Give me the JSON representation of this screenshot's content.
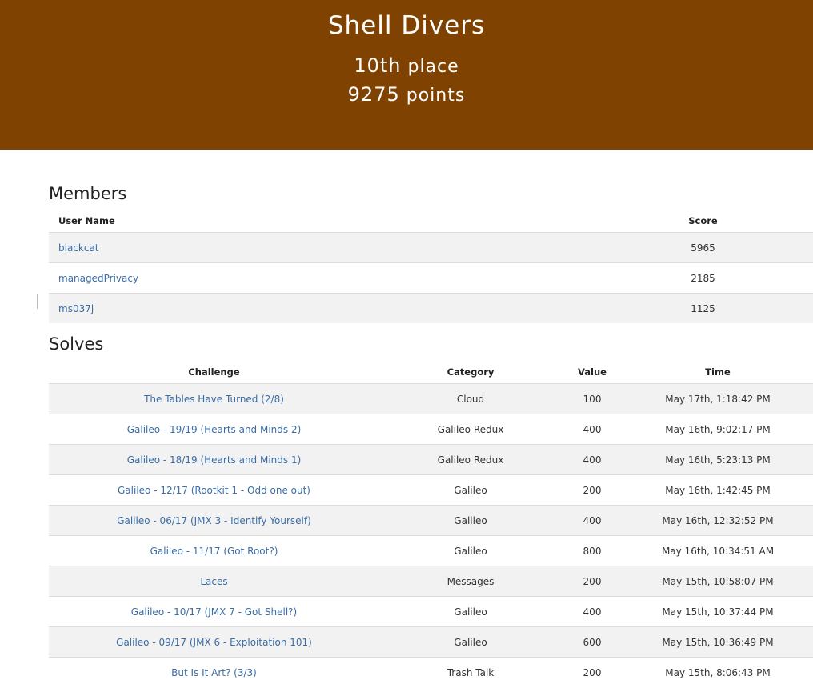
{
  "team": {
    "name": "Shell Divers",
    "place_number": "10th",
    "place_word": "place",
    "points_number": "9275",
    "points_word": "points",
    "banner_color": "#7f4201"
  },
  "members": {
    "title": "Members",
    "headers": {
      "user": "User Name",
      "score": "Score"
    },
    "rows": [
      {
        "user": "blackcat",
        "score": "5965"
      },
      {
        "user": "managedPrivacy",
        "score": "2185"
      },
      {
        "user": "ms037j",
        "score": "1125"
      }
    ]
  },
  "solves": {
    "title": "Solves",
    "headers": {
      "challenge": "Challenge",
      "category": "Category",
      "value": "Value",
      "time": "Time"
    },
    "rows": [
      {
        "challenge": "The Tables Have Turned (2/8)",
        "category": "Cloud",
        "value": "100",
        "time": "May 17th, 1:18:42 PM"
      },
      {
        "challenge": "Galileo - 19/19 (Hearts and Minds 2)",
        "category": "Galileo Redux",
        "value": "400",
        "time": "May 16th, 9:02:17 PM"
      },
      {
        "challenge": "Galileo - 18/19 (Hearts and Minds 1)",
        "category": "Galileo Redux",
        "value": "400",
        "time": "May 16th, 5:23:13 PM"
      },
      {
        "challenge": "Galileo - 12/17 (Rootkit 1 - Odd one out)",
        "category": "Galileo",
        "value": "200",
        "time": "May 16th, 1:42:45 PM"
      },
      {
        "challenge": "Galileo - 06/17 (JMX 3 - Identify Yourself)",
        "category": "Galileo",
        "value": "400",
        "time": "May 16th, 12:32:52 PM"
      },
      {
        "challenge": "Galileo - 11/17 (Got Root?)",
        "category": "Galileo",
        "value": "800",
        "time": "May 16th, 10:34:51 AM"
      },
      {
        "challenge": "Laces",
        "category": "Messages",
        "value": "200",
        "time": "May 15th, 10:58:07 PM"
      },
      {
        "challenge": "Galileo - 10/17 (JMX 7 - Got Shell?)",
        "category": "Galileo",
        "value": "400",
        "time": "May 15th, 10:37:44 PM"
      },
      {
        "challenge": "Galileo - 09/17 (JMX 6 - Exploitation 101)",
        "category": "Galileo",
        "value": "600",
        "time": "May 15th, 10:36:49 PM"
      },
      {
        "challenge": "But Is It Art? (3/3)",
        "category": "Trash Talk",
        "value": "200",
        "time": "May 15th, 8:06:43 PM"
      }
    ]
  }
}
